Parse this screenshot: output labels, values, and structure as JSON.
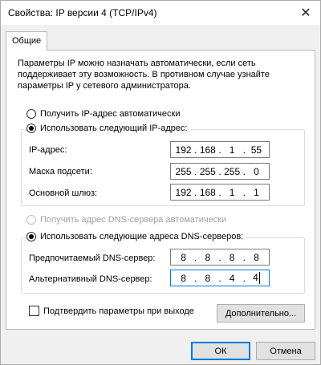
{
  "window": {
    "title": "Свойства: IP версии 4 (TCP/IPv4)",
    "close_glyph": "✕"
  },
  "tabs": [
    {
      "label": "Общие"
    }
  ],
  "description": "Параметры IP можно назначать автоматически, если сеть поддерживает эту возможность. В противном случае узнайте параметры IP у сетевого администратора.",
  "ip_mode": {
    "auto_label": "Получить IP-адрес автоматически",
    "manual_label": "Использовать следующий IP-адрес:",
    "selected": "manual"
  },
  "ip_fields": {
    "ip": {
      "label": "IP-адрес:",
      "octets": [
        "192",
        "168",
        "1",
        "55"
      ]
    },
    "mask": {
      "label": "Маска подсети:",
      "octets": [
        "255",
        "255",
        "255",
        "0"
      ]
    },
    "gateway": {
      "label": "Основной шлюз:",
      "octets": [
        "192",
        "168",
        "1",
        "1"
      ]
    }
  },
  "dns_mode": {
    "auto_label": "Получить адрес DNS-сервера автоматически",
    "manual_label": "Использовать следующие адреса DNS-серверов:",
    "selected": "manual"
  },
  "dns_fields": {
    "preferred": {
      "label": "Предпочитаемый DNS-сервер:",
      "octets": [
        "8",
        "8",
        "8",
        "8"
      ]
    },
    "alternate": {
      "label": "Альтернативный DNS-сервер:",
      "octets": [
        "8",
        "8",
        "4",
        "4"
      ]
    }
  },
  "validate_on_exit": {
    "label": "Подтвердить параметры при выходе",
    "checked": false
  },
  "buttons": {
    "advanced": "Дополнительно...",
    "ok": "ОК",
    "cancel": "Отмена"
  },
  "colors": {
    "focus": "#0078d7",
    "disabled_text": "#a0a0a0"
  }
}
